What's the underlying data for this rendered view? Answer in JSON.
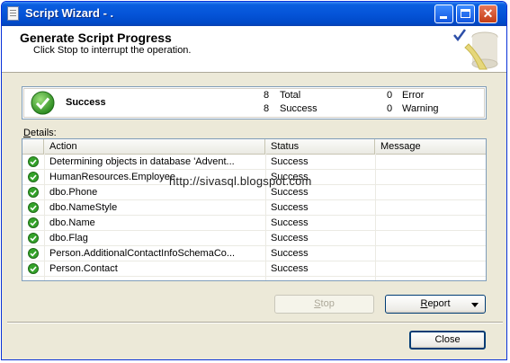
{
  "window": {
    "title": "Script Wizard - ."
  },
  "header": {
    "title": "Generate Script Progress",
    "subtitle": "Click Stop to interrupt the operation."
  },
  "summary": {
    "status": "Success",
    "total_count": "8",
    "total_label": "Total",
    "success_count": "8",
    "success_label": "Success",
    "error_count": "0",
    "error_label": "Error",
    "warning_count": "0",
    "warning_label": "Warning"
  },
  "details": {
    "label_accel": "D",
    "label_rest": "etails:",
    "columns": [
      "Action",
      "Status",
      "Message"
    ],
    "rows": [
      {
        "action": "Determining objects in database 'Advent...",
        "status": "Success",
        "message": ""
      },
      {
        "action": "HumanResources.Employee",
        "status": "Success",
        "message": ""
      },
      {
        "action": "dbo.Phone",
        "status": "Success",
        "message": ""
      },
      {
        "action": "dbo.NameStyle",
        "status": "Success",
        "message": ""
      },
      {
        "action": "dbo.Name",
        "status": "Success",
        "message": ""
      },
      {
        "action": "dbo.Flag",
        "status": "Success",
        "message": ""
      },
      {
        "action": "Person.AdditionalContactInfoSchemaCo...",
        "status": "Success",
        "message": ""
      },
      {
        "action": "Person.Contact",
        "status": "Success",
        "message": ""
      }
    ]
  },
  "watermark": "http://sivasql.blogspot.com",
  "buttons": {
    "stop_accel": "S",
    "stop_rest": "top",
    "report_accel": "R",
    "report_rest": "eport",
    "close": "Close"
  },
  "colors": {
    "titlebar": "#0554d8",
    "success_green": "#2e9a2e",
    "window_bg": "#ece9d8"
  }
}
